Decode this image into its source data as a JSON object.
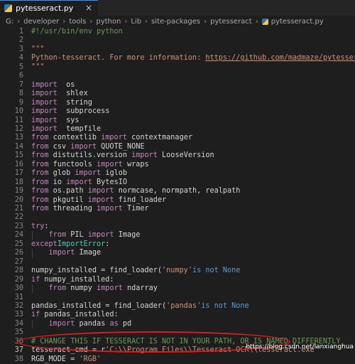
{
  "tab": {
    "label": "pytesseract.py",
    "close": "×"
  },
  "breadcrumb": [
    "G:",
    "developer",
    "tools",
    "python",
    "Lib",
    "site-packages",
    "pytesseract",
    "pytesseract.py"
  ],
  "lines": [
    {
      "n": "1",
      "parts": [
        [
          "c",
          "#!/usr/bin/env python"
        ]
      ]
    },
    {
      "n": "2",
      "parts": []
    },
    {
      "n": "3",
      "parts": [
        [
          "s",
          "\"\"\""
        ]
      ]
    },
    {
      "n": "4",
      "parts": [
        [
          "s",
          "Python-tesseract. For more information: "
        ],
        [
          "lnk",
          "https://github.com/madmaze/pytesseract"
        ]
      ]
    },
    {
      "n": "5",
      "parts": [
        [
          "s",
          "\"\"\""
        ]
      ]
    },
    {
      "n": "6",
      "parts": []
    },
    {
      "n": "7",
      "parts": [
        [
          "k",
          "import"
        ],
        [
          "",
          "  os"
        ]
      ]
    },
    {
      "n": "8",
      "parts": [
        [
          "k",
          "import"
        ],
        [
          "",
          "  shlex"
        ]
      ]
    },
    {
      "n": "9",
      "parts": [
        [
          "k",
          "import"
        ],
        [
          "",
          "  string"
        ]
      ]
    },
    {
      "n": "10",
      "parts": [
        [
          "k",
          "import"
        ],
        [
          "",
          "  subprocess"
        ]
      ]
    },
    {
      "n": "11",
      "parts": [
        [
          "k",
          "import"
        ],
        [
          "",
          "  sys"
        ]
      ]
    },
    {
      "n": "12",
      "parts": [
        [
          "k",
          "import"
        ],
        [
          "",
          "  tempfile"
        ]
      ]
    },
    {
      "n": "13",
      "parts": [
        [
          "k",
          "from"
        ],
        [
          "",
          " contextlib "
        ],
        [
          "k",
          "import"
        ],
        [
          "",
          " contextmanager"
        ]
      ]
    },
    {
      "n": "14",
      "parts": [
        [
          "k",
          "from"
        ],
        [
          "",
          " csv "
        ],
        [
          "k",
          "import"
        ],
        [
          "",
          " QUOTE_NONE"
        ]
      ]
    },
    {
      "n": "15",
      "parts": [
        [
          "k",
          "from"
        ],
        [
          "",
          " distutils.version "
        ],
        [
          "k",
          "import"
        ],
        [
          "",
          " LooseVersion"
        ]
      ]
    },
    {
      "n": "16",
      "parts": [
        [
          "k",
          "from"
        ],
        [
          "",
          " functools "
        ],
        [
          "k",
          "import"
        ],
        [
          "",
          " wraps"
        ]
      ]
    },
    {
      "n": "17",
      "parts": [
        [
          "k",
          "from"
        ],
        [
          "",
          " glob "
        ],
        [
          "k",
          "import"
        ],
        [
          "",
          " iglob"
        ]
      ]
    },
    {
      "n": "18",
      "parts": [
        [
          "k",
          "from"
        ],
        [
          "",
          " io "
        ],
        [
          "k",
          "import"
        ],
        [
          "",
          " BytesIO"
        ]
      ]
    },
    {
      "n": "19",
      "parts": [
        [
          "k",
          "from"
        ],
        [
          "",
          " os.path "
        ],
        [
          "k",
          "import"
        ],
        [
          "",
          " normcase, normpath, realpath"
        ]
      ]
    },
    {
      "n": "20",
      "parts": [
        [
          "k",
          "from"
        ],
        [
          "",
          " pkgutil "
        ],
        [
          "k",
          "import"
        ],
        [
          "",
          " find_loader"
        ]
      ]
    },
    {
      "n": "21",
      "parts": [
        [
          "k",
          "from"
        ],
        [
          "",
          " threading "
        ],
        [
          "k",
          "import"
        ],
        [
          "",
          " Timer"
        ]
      ]
    },
    {
      "n": "22",
      "parts": []
    },
    {
      "n": "23",
      "parts": [
        [
          "k",
          "try"
        ],
        [
          "",
          ":"
        ]
      ]
    },
    {
      "n": "24",
      "indent": true,
      "parts": [
        [
          "",
          "    "
        ],
        [
          "k",
          "from"
        ],
        [
          "",
          " PIL "
        ],
        [
          "k",
          "import"
        ],
        [
          "",
          " Image"
        ]
      ]
    },
    {
      "n": "25",
      "parts": [
        [
          "k",
          "except"
        ],
        [
          " ",
          ""
        ],
        [
          "t",
          "ImportError"
        ],
        [
          "",
          ":"
        ]
      ]
    },
    {
      "n": "26",
      "indent": true,
      "parts": [
        [
          "",
          "    "
        ],
        [
          "k",
          "import"
        ],
        [
          "",
          " Image"
        ]
      ]
    },
    {
      "n": "27",
      "parts": []
    },
    {
      "n": "28",
      "parts": [
        [
          "",
          "numpy_installed = find_loader("
        ],
        [
          "s",
          "'numpy'"
        ],
        [
          ") "
        ],
        [
          "b",
          "is not None"
        ]
      ]
    },
    {
      "n": "29",
      "parts": [
        [
          "k",
          "if"
        ],
        [
          "",
          " numpy_installed:"
        ]
      ]
    },
    {
      "n": "30",
      "indent": true,
      "parts": [
        [
          "",
          "    "
        ],
        [
          "k",
          "from"
        ],
        [
          "",
          " numpy "
        ],
        [
          "k",
          "import"
        ],
        [
          "",
          " ndarray"
        ]
      ]
    },
    {
      "n": "31",
      "parts": []
    },
    {
      "n": "32",
      "parts": [
        [
          "",
          "pandas_installed = find_loader("
        ],
        [
          "s",
          "'pandas'"
        ],
        [
          ") "
        ],
        [
          "b",
          "is not None"
        ]
      ]
    },
    {
      "n": "33",
      "parts": [
        [
          "k",
          "if"
        ],
        [
          "",
          " pandas_installed:"
        ]
      ]
    },
    {
      "n": "34",
      "indent": true,
      "parts": [
        [
          "",
          "    "
        ],
        [
          "k",
          "import"
        ],
        [
          "",
          " pandas "
        ],
        [
          "k",
          "as"
        ],
        [
          "",
          " pd"
        ]
      ]
    },
    {
      "n": "35",
      "parts": []
    },
    {
      "n": "36",
      "parts": [
        [
          "c",
          "# CHANGE THIS IF TESSERACT IS NOT IN YOUR PATH, OR IS NAMED DIFFERENTLY"
        ]
      ]
    },
    {
      "n": "37",
      "active": true,
      "parts": [
        [
          "",
          "tesseract_cmd = r"
        ],
        [
          "s",
          "'C:\\\\Program Files\\\\Tesseract-OCR\\\\tesseract.exe'"
        ]
      ]
    },
    {
      "n": "38",
      "parts": [
        [
          "",
          "RGB_MODE = "
        ],
        [
          "s",
          "'RGB'"
        ]
      ]
    }
  ],
  "watermark": "https://blog.csdn.net/lanxianghua"
}
